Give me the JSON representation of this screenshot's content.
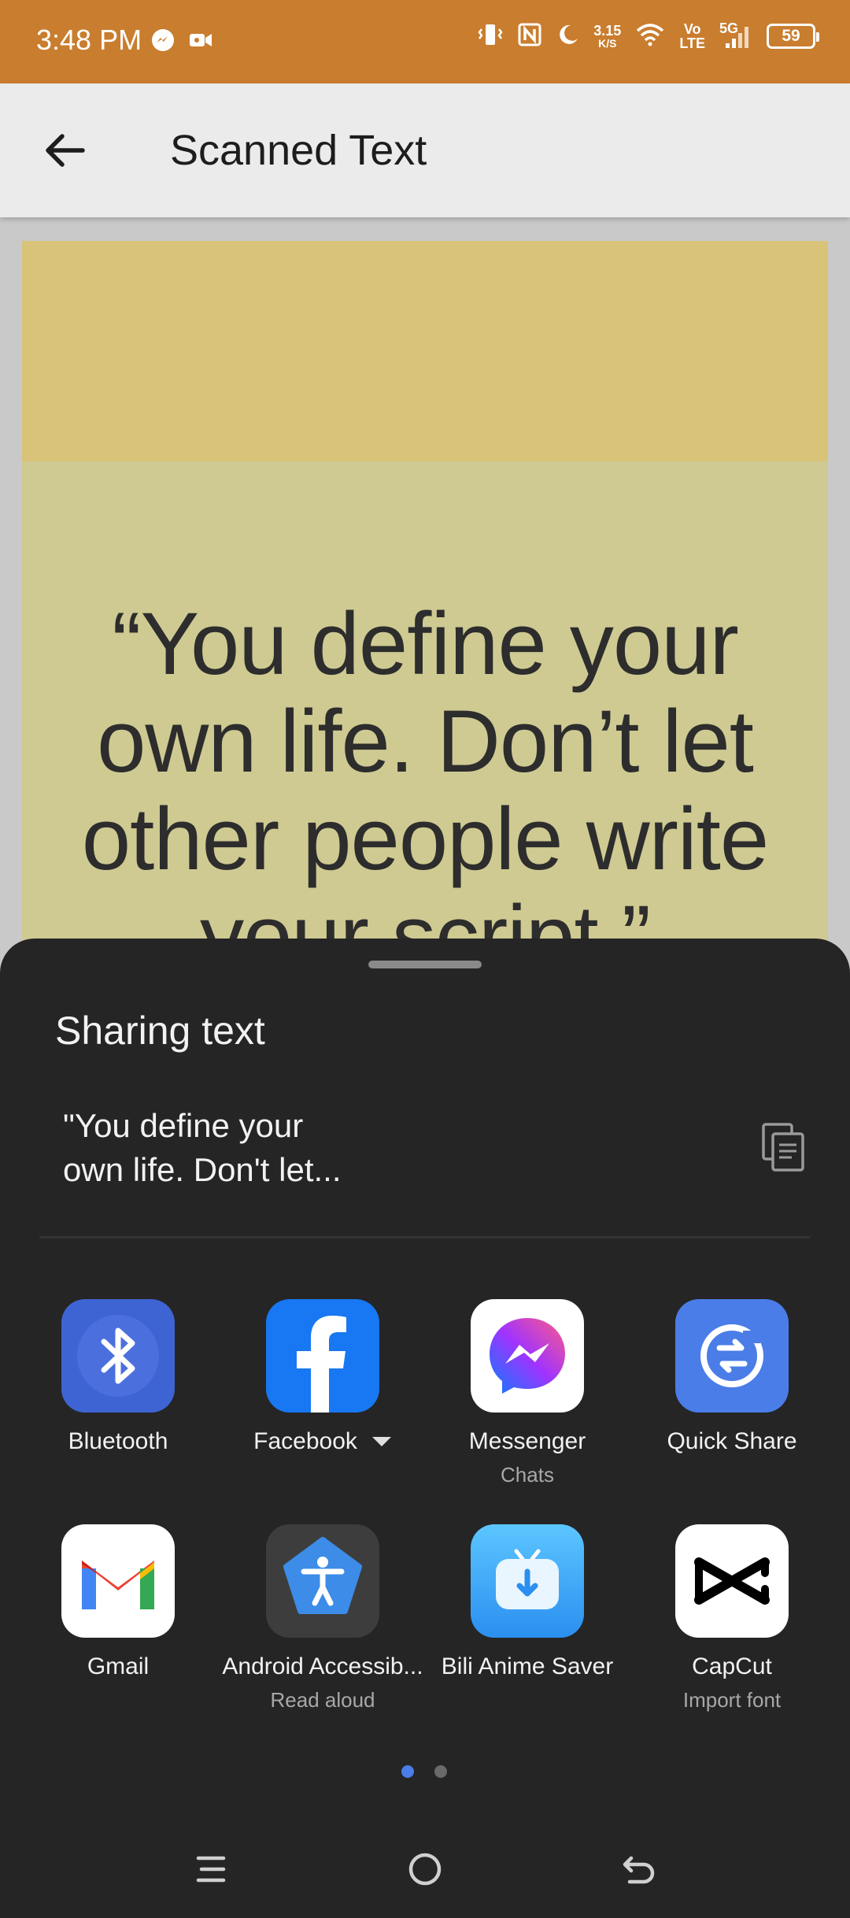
{
  "status_bar": {
    "time": "3:48 PM",
    "net_speed_value": "3.15",
    "net_speed_unit": "K/S",
    "volte_top": "Vo",
    "volte_bottom": "LTE",
    "network_type": "5G",
    "battery_level": "59",
    "icons": [
      "messenger-icon",
      "video-icon",
      "vibrate-icon",
      "nfc-icon",
      "moon-icon",
      "wifi-icon",
      "signal-icon",
      "battery-icon"
    ]
  },
  "app_bar": {
    "title": "Scanned Text",
    "back_icon": "arrow-left-icon"
  },
  "scanned_image": {
    "quote_line_1": "“You define your",
    "quote_line_2": "own life. Don’t let",
    "quote_line_3": "other people write",
    "quote_line_4": "your script.”"
  },
  "share_sheet": {
    "title": "Sharing text",
    "preview_line_1": "\"You define your",
    "preview_line_2": "own life. Don't let...",
    "copy_icon": "copy-icon",
    "apps": [
      {
        "label": "Bluetooth",
        "sublabel": "",
        "icon": "bluetooth-icon",
        "color": "#3e64d3"
      },
      {
        "label": "Facebook",
        "sublabel": "",
        "icon": "facebook-icon",
        "color": "#1877f2"
      },
      {
        "label": "Messenger",
        "sublabel": "Chats",
        "icon": "messenger-icon",
        "color": "#ffffff"
      },
      {
        "label": "Quick Share",
        "sublabel": "",
        "icon": "quick-share-icon",
        "color": "#4a7de8"
      },
      {
        "label": "Gmail",
        "sublabel": "",
        "icon": "gmail-icon",
        "color": "#ffffff"
      },
      {
        "label": "Android Accessib...",
        "sublabel": "Read aloud",
        "icon": "accessibility-icon",
        "color": "#3d3d3d"
      },
      {
        "label": "Bili Anime Saver",
        "sublabel": "",
        "icon": "bili-anime-saver-icon",
        "color": "#33a6f5"
      },
      {
        "label": "CapCut",
        "sublabel": "Import font",
        "icon": "capcut-icon",
        "color": "#ffffff"
      }
    ],
    "page_count": 2,
    "current_page": 1
  },
  "nav_bar": {
    "icons": [
      "menu-icon",
      "home-icon",
      "back-icon"
    ]
  }
}
